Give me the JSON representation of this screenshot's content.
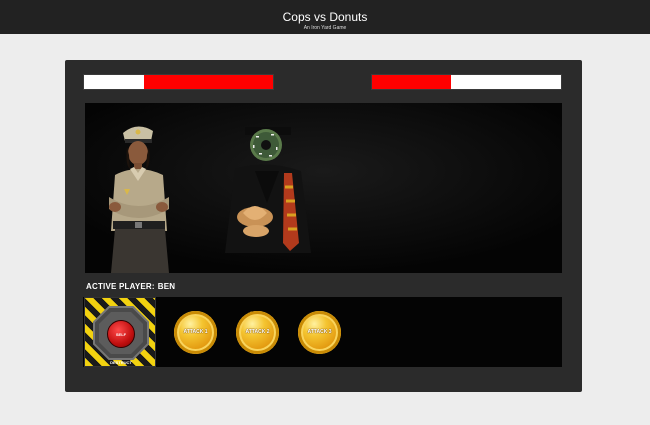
{
  "header": {
    "title": "Cops vs Donuts",
    "subtitle": "An Iron Yard Game"
  },
  "players": {
    "cop": {
      "health_percent": 68
    },
    "donut": {
      "health_percent": 42
    }
  },
  "status": {
    "label": "ACTIVE PLAYER:",
    "name": "BEN"
  },
  "controls": {
    "self_destruct_label": "SELF DESTRUCT",
    "attacks": [
      "ATTACK 1",
      "ATTACK 2",
      "ATTACK 3"
    ]
  },
  "colors": {
    "health_fill": "#ff0000",
    "health_empty": "#ffffff",
    "hazard_yellow": "#f2d210",
    "coin_gold": "#f4c430"
  }
}
